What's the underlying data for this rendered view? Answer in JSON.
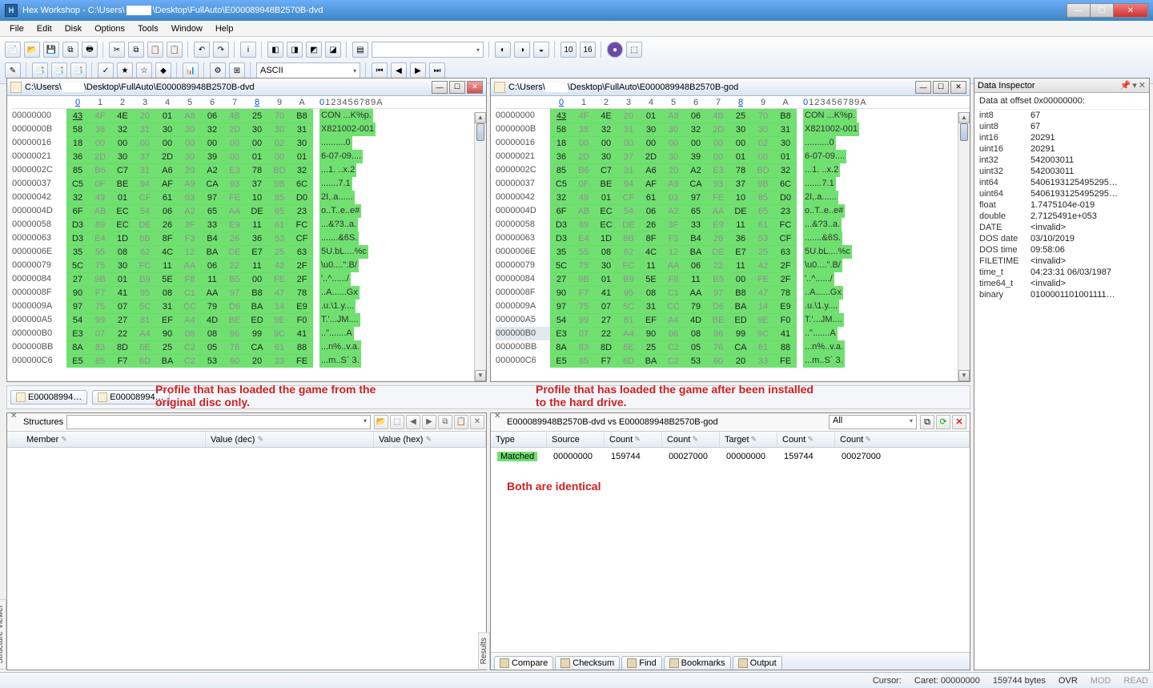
{
  "titlebar": {
    "app": "Hex Workshop",
    "path_pre": "C:\\Users\\",
    "path_post": "\\Desktop\\FullAuto\\E000089948B2570B-dvd"
  },
  "menu": [
    "File",
    "Edit",
    "Disk",
    "Options",
    "Tools",
    "Window",
    "Help"
  ],
  "encoding": "ASCII",
  "panes": [
    {
      "title_pre": "C:\\Users\\",
      "title_post": "\\Desktop\\FullAuto\\E000089948B2570B-dvd"
    },
    {
      "title_pre": "C:\\Users\\",
      "title_post": "\\Desktop\\FullAuto\\E000089948B2570B-god"
    }
  ],
  "hexcols": [
    "0",
    "1",
    "2",
    "3",
    "4",
    "5",
    "6",
    "7",
    "8",
    "9",
    "A"
  ],
  "asciiheader": "0123456789A",
  "hexrows": [
    {
      "a": "00000000",
      "b": [
        "43",
        "4F",
        "4E",
        "20",
        "01",
        "A8",
        "06",
        "4B",
        "25",
        "70",
        "B8"
      ],
      "t": "CON ...K%p."
    },
    {
      "a": "0000000B",
      "b": [
        "58",
        "38",
        "32",
        "31",
        "30",
        "30",
        "32",
        "2D",
        "30",
        "30",
        "31"
      ],
      "t": "X821002-001"
    },
    {
      "a": "00000016",
      "b": [
        "18",
        "00",
        "00",
        "00",
        "00",
        "00",
        "00",
        "00",
        "00",
        "02",
        "30"
      ],
      "t": "..........0"
    },
    {
      "a": "00000021",
      "b": [
        "36",
        "2D",
        "30",
        "37",
        "2D",
        "30",
        "39",
        "00",
        "01",
        "00",
        "01"
      ],
      "t": "6-07-09...."
    },
    {
      "a": "0000002C",
      "b": [
        "85",
        "B6",
        "C7",
        "31",
        "A6",
        "20",
        "A2",
        "E3",
        "78",
        "BD",
        "32"
      ],
      "t": "...1. ..x.2"
    },
    {
      "a": "00000037",
      "b": [
        "C5",
        "0F",
        "BE",
        "94",
        "AF",
        "A9",
        "CA",
        "93",
        "37",
        "9B",
        "6C"
      ],
      "t": ".......7.1"
    },
    {
      "a": "00000042",
      "b": [
        "32",
        "49",
        "01",
        "CF",
        "61",
        "03",
        "97",
        "FE",
        "10",
        "85",
        "D0"
      ],
      "t": "2I,.a......"
    },
    {
      "a": "0000004D",
      "b": [
        "6F",
        "AB",
        "EC",
        "54",
        "06",
        "A2",
        "65",
        "AA",
        "DE",
        "65",
        "23"
      ],
      "t": "o..T..e..e#"
    },
    {
      "a": "00000058",
      "b": [
        "D3",
        "89",
        "EC",
        "DE",
        "26",
        "3F",
        "33",
        "E9",
        "11",
        "61",
        "FC"
      ],
      "t": "...&?3..a."
    },
    {
      "a": "00000063",
      "b": [
        "D3",
        "E4",
        "1D",
        "8B",
        "8F",
        "F3",
        "B4",
        "26",
        "36",
        "53",
        "CF"
      ],
      "t": ".......&6S."
    },
    {
      "a": "0000006E",
      "b": [
        "35",
        "55",
        "08",
        "62",
        "4C",
        "12",
        "BA",
        "DE",
        "E7",
        "25",
        "63"
      ],
      "t": "5U.bL....%c"
    },
    {
      "a": "00000079",
      "b": [
        "5C",
        "75",
        "30",
        "FC",
        "11",
        "AA",
        "06",
        "22",
        "11",
        "42",
        "2F"
      ],
      "t": "\\u0....\".B/"
    },
    {
      "a": "00000084",
      "b": [
        "27",
        "9B",
        "01",
        "B9",
        "5E",
        "F8",
        "11",
        "B5",
        "00",
        "FE",
        "2F"
      ],
      "t": "'..^....../"
    },
    {
      "a": "0000008F",
      "b": [
        "90",
        "F7",
        "41",
        "95",
        "08",
        "C1",
        "AA",
        "97",
        "B8",
        "47",
        "78"
      ],
      "t": "..A......Gx"
    },
    {
      "a": "0000009A",
      "b": [
        "97",
        "75",
        "07",
        "5C",
        "31",
        "CC",
        "79",
        "D6",
        "BA",
        "14",
        "E9"
      ],
      "t": ".u.\\1.y...."
    },
    {
      "a": "000000A5",
      "b": [
        "54",
        "99",
        "27",
        "81",
        "EF",
        "A4",
        "4D",
        "BE",
        "ED",
        "9E",
        "F0"
      ],
      "t": "T.'...JM...."
    },
    {
      "a": "000000B0",
      "b": [
        "E3",
        "07",
        "22",
        "A4",
        "90",
        "06",
        "08",
        "96",
        "99",
        "9C",
        "41"
      ],
      "t": "..\".......A"
    },
    {
      "a": "000000BB",
      "b": [
        "8A",
        "83",
        "8D",
        "6E",
        "25",
        "C2",
        "05",
        "76",
        "CA",
        "61",
        "88"
      ],
      "t": "...n%..v.a."
    },
    {
      "a": "000000C6",
      "b": [
        "E5",
        "85",
        "F7",
        "6D",
        "BA",
        "C2",
        "53",
        "60",
        "20",
        "33",
        "FE"
      ],
      "t": "...m..S` 3."
    }
  ],
  "tabs": [
    "E00008994…",
    "E00008994…"
  ],
  "redtext_left": "Profile that has loaded the game from the original disc only.",
  "redtext_right": "Profile that has loaded the game after been installed to the hard drive.",
  "redtext_identical": "Both are identical",
  "inspector": {
    "title": "Data Inspector",
    "subtitle": "Data at offset 0x00000000:",
    "rows": [
      {
        "k": "int8",
        "v": "67"
      },
      {
        "k": "uint8",
        "v": "67"
      },
      {
        "k": "int16",
        "v": "20291"
      },
      {
        "k": "uint16",
        "v": "20291"
      },
      {
        "k": "int32",
        "v": "542003011"
      },
      {
        "k": "uint32",
        "v": "542003011"
      },
      {
        "k": "int64",
        "v": "5406193125495295…"
      },
      {
        "k": "uint64",
        "v": "5406193125495295…"
      },
      {
        "k": "float",
        "v": "1.7475104e-019"
      },
      {
        "k": "double",
        "v": "2.7125491e+053"
      },
      {
        "k": "DATE",
        "v": "<invalid>"
      },
      {
        "k": "DOS date",
        "v": "03/10/2019"
      },
      {
        "k": "DOS time",
        "v": "09:58:06"
      },
      {
        "k": "FILETIME",
        "v": "<invalid>"
      },
      {
        "k": "time_t",
        "v": "04:23:31 06/03/1987"
      },
      {
        "k": "time64_t",
        "v": "<invalid>"
      },
      {
        "k": "binary",
        "v": "0100001101001111…"
      }
    ]
  },
  "struct": {
    "title": "Structures",
    "cols": [
      "Member",
      "Value (dec)",
      "Value (hex)"
    ],
    "sidetab": "Structure Viewer"
  },
  "result": {
    "title": "E000089948B2570B-dvd vs E000089948B2570B-god",
    "filter": "All",
    "cols": [
      "Type",
      "Source",
      "Count",
      "Count",
      "Target",
      "Count",
      "Count"
    ],
    "row": {
      "type": "Matched",
      "source": "00000000",
      "c1": "159744",
      "c2": "00027000",
      "target": "00000000",
      "c3": "159744",
      "c4": "00027000"
    },
    "tabs": [
      "Compare",
      "Checksum",
      "Find",
      "Bookmarks",
      "Output"
    ],
    "sidetab": "Results"
  },
  "statusbar": {
    "cursor_label": "Cursor:",
    "caret": "Caret: 00000000",
    "bytes": "159744 bytes",
    "modes": [
      "OVR",
      "MOD",
      "READ"
    ]
  }
}
